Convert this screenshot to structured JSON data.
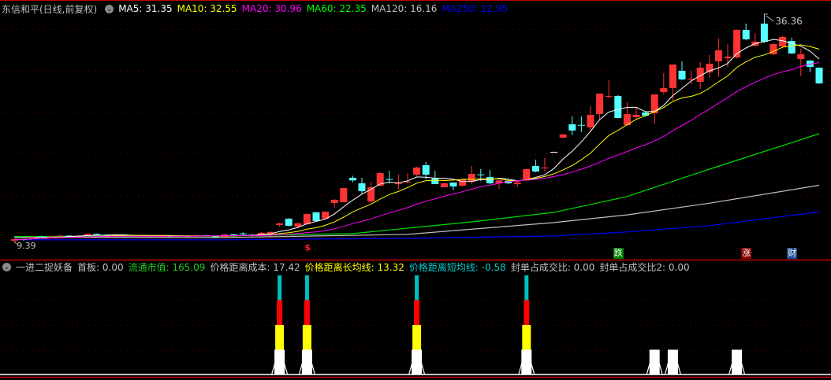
{
  "header": {
    "title": "东信和平(日线,前复权)",
    "ma": [
      {
        "label": "MA5: 31.35",
        "color": "#ffffff"
      },
      {
        "label": "MA10: 32.55",
        "color": "#ffff00"
      },
      {
        "label": "MA20: 30.96",
        "color": "#ff00ff"
      },
      {
        "label": "MA60: 22.35",
        "color": "#00ff00"
      },
      {
        "label": "MA120: 16.16",
        "color": "#c0c0c0"
      },
      {
        "label": "MA250: 12.95",
        "color": "#0000ff"
      }
    ]
  },
  "indicator": {
    "name": "一进二捉妖备",
    "items": [
      {
        "label": "首板: 0.00",
        "color": "#c0c0c0"
      },
      {
        "label": "流通市值: 165.09",
        "color": "#22cc22"
      },
      {
        "label": "价格距离成本: 17.42",
        "color": "#c0c0c0"
      },
      {
        "label": "价格距离长均线: 13.32",
        "color": "#ffff00"
      },
      {
        "label": "价格距离短均线: -0.58",
        "color": "#00cccc"
      },
      {
        "label": "封单占成交比: 0.00",
        "color": "#c0c0c0"
      },
      {
        "label": "封单占成交比2: 0.00",
        "color": "#c0c0c0"
      }
    ],
    "signals": [
      {
        "i": 29,
        "level": 4
      },
      {
        "i": 32,
        "level": 4
      },
      {
        "i": 44,
        "level": 4
      },
      {
        "i": 56,
        "level": 4
      },
      {
        "i": 70,
        "level": 1
      },
      {
        "i": 72,
        "level": 1
      },
      {
        "i": 79,
        "level": 1
      }
    ],
    "segment_colors": [
      "#ffffff",
      "#ffff00",
      "#ff0000",
      "#00c0c0"
    ]
  },
  "markers": {
    "high_label": "36.36",
    "low_label": "9.39",
    "tags": [
      {
        "text": "跌",
        "i": 66,
        "color": "#008000"
      },
      {
        "text": "涨",
        "i": 80,
        "color": "#8b0000"
      },
      {
        "text": "财",
        "i": 85,
        "color": "#1f4f8f"
      }
    ],
    "dollar": {
      "text": "$",
      "i": 32
    }
  },
  "colors": {
    "up": "#ff3333",
    "down": "#54ffff",
    "grid": "#8b0000",
    "border": "#c00000"
  },
  "chart_data": {
    "type": "candlestick",
    "price_range": [
      9.39,
      36.36
    ],
    "ohlc": [
      [
        9.5,
        9.65,
        9.7,
        9.39
      ],
      [
        9.7,
        9.6,
        9.75,
        9.5
      ],
      [
        9.8,
        9.9,
        10.0,
        9.75
      ],
      [
        10.0,
        9.95,
        10.1,
        9.9
      ],
      [
        9.9,
        10.0,
        10.05,
        9.85
      ],
      [
        10.05,
        10.1,
        10.2,
        10.0
      ],
      [
        10.1,
        10.05,
        10.15,
        9.95
      ],
      [
        10.0,
        10.1,
        10.15,
        9.95
      ],
      [
        10.1,
        10.3,
        10.35,
        10.05
      ],
      [
        10.3,
        10.2,
        10.35,
        10.1
      ],
      [
        10.2,
        10.15,
        10.25,
        10.1
      ],
      [
        10.1,
        10.2,
        10.3,
        10.05
      ],
      [
        10.2,
        10.1,
        10.25,
        10.0
      ],
      [
        10.1,
        10.05,
        10.2,
        10.0
      ],
      [
        10.0,
        10.1,
        10.15,
        9.95
      ],
      [
        10.1,
        10.0,
        10.15,
        9.95
      ],
      [
        9.95,
        10.05,
        10.1,
        9.9
      ],
      [
        10.05,
        10.0,
        10.1,
        9.9
      ],
      [
        10.0,
        10.1,
        10.2,
        9.95
      ],
      [
        10.1,
        10.0,
        10.15,
        9.95
      ],
      [
        10.0,
        10.15,
        10.2,
        9.95
      ],
      [
        10.15,
        10.05,
        10.2,
        10.0
      ],
      [
        10.0,
        9.95,
        10.1,
        9.85
      ],
      [
        9.97,
        10.25,
        10.3,
        9.9
      ],
      [
        10.25,
        10.06,
        10.3,
        10.0
      ],
      [
        10.37,
        10.35,
        10.5,
        10.2
      ],
      [
        10.2,
        10.1,
        10.3,
        10.0
      ],
      [
        10.16,
        10.44,
        10.55,
        10.1
      ],
      [
        10.35,
        10.54,
        10.65,
        10.3
      ],
      [
        11.39,
        11.57,
        11.67,
        11.2
      ],
      [
        12.14,
        11.29,
        12.2,
        11.2
      ],
      [
        11.2,
        11.57,
        11.7,
        11.1
      ],
      [
        11.48,
        12.71,
        12.75,
        11.4
      ],
      [
        12.9,
        11.86,
        12.95,
        11.8
      ],
      [
        12.14,
        12.99,
        13.0,
        12.1
      ],
      [
        14.03,
        14.41,
        14.5,
        13.47
      ],
      [
        14.13,
        15.83,
        15.85,
        14.1
      ],
      [
        17.06,
        16.74,
        17.3,
        16.5
      ],
      [
        16.39,
        15.45,
        17.06,
        15.17
      ],
      [
        14.22,
        15.92,
        16.58,
        14.03
      ],
      [
        16.11,
        17.63,
        17.7,
        16.0
      ],
      [
        16.9,
        16.87,
        17.91,
        16.39
      ],
      [
        16.3,
        16.39,
        17.44,
        15.64
      ],
      [
        16.55,
        16.6,
        17.63,
        16.4
      ],
      [
        17.44,
        18.29,
        18.4,
        17.3
      ],
      [
        18.57,
        17.44,
        18.95,
        16.87
      ],
      [
        16.97,
        16.3,
        17.91,
        16.3
      ],
      [
        15.92,
        16.39,
        16.45,
        15.9
      ],
      [
        16.49,
        16.02,
        16.5,
        15.54
      ],
      [
        16.11,
        16.87,
        16.9,
        16.0
      ],
      [
        16.58,
        17.53,
        18.48,
        16.3
      ],
      [
        17.46,
        17.44,
        18.1,
        16.68
      ],
      [
        17.16,
        16.39,
        18.01,
        16.3
      ],
      [
        16.39,
        16.74,
        16.8,
        15.73
      ],
      [
        16.68,
        16.39,
        16.75,
        16.3
      ],
      [
        16.3,
        16.49,
        16.55,
        15.92
      ],
      [
        16.74,
        18.1,
        18.15,
        16.7
      ],
      [
        18.48,
        17.81,
        19.24,
        17.72
      ],
      [
        18.25,
        18.29,
        19.43,
        17.81
      ],
      [
        20.18,
        20.18,
        20.18,
        20.18
      ],
      [
        21.89,
        22.27,
        22.3,
        21.8
      ],
      [
        23.49,
        22.74,
        24.44,
        22.17
      ],
      [
        23.42,
        23.4,
        24.44,
        22.55
      ],
      [
        23.12,
        24.63,
        25.67,
        22.74
      ],
      [
        24.72,
        27.18,
        27.2,
        24.06
      ],
      [
        26.88,
        26.9,
        28.79,
        26.62
      ],
      [
        26.9,
        24.25,
        27.0,
        24.2
      ],
      [
        23.4,
        24.72,
        26.14,
        23.3
      ],
      [
        24.35,
        24.63,
        25.48,
        24.06
      ],
      [
        24.91,
        24.54,
        25.0,
        24.4
      ],
      [
        24.82,
        27.09,
        27.1,
        23.49
      ],
      [
        27.37,
        27.85,
        29.64,
        27.09
      ],
      [
        27.85,
        30.68,
        30.7,
        26.33
      ],
      [
        29.93,
        28.89,
        31.06,
        28.8
      ],
      [
        28.96,
        28.98,
        29.93,
        28.32
      ],
      [
        28.6,
        30.3,
        30.97,
        27.75
      ],
      [
        29.74,
        30.78,
        31.82,
        29.08
      ],
      [
        31.06,
        32.39,
        33.81,
        29.17
      ],
      [
        31.44,
        31.63,
        33.14,
        30.4
      ],
      [
        31.54,
        34.85,
        34.9,
        31.4
      ],
      [
        34.85,
        33.71,
        35.6,
        33.6
      ],
      [
        32.95,
        33.43,
        34.47,
        32.77
      ],
      [
        35.6,
        33.43,
        36.36,
        33.3
      ],
      [
        31.91,
        33.14,
        33.2,
        31.8
      ],
      [
        32.86,
        34.0,
        34.1,
        32.77
      ],
      [
        33.52,
        32.01,
        33.9,
        31.95
      ],
      [
        31.35,
        31.91,
        32.58,
        29.27
      ],
      [
        31.16,
        30.4,
        31.2,
        29.74
      ],
      [
        30.3,
        28.41,
        30.35,
        28.35
      ]
    ],
    "computed_ma": [
      {
        "name": "MA5",
        "period": 5,
        "color": "#ffffff"
      },
      {
        "name": "MA10",
        "period": 10,
        "color": "#ffff00"
      },
      {
        "name": "MA20",
        "period": 20,
        "color": "#ff00ff"
      }
    ],
    "long_ma": [
      {
        "name": "MA60",
        "color": "#00dd00",
        "points": [
          [
            0,
            10.0
          ],
          [
            23,
            10.06
          ],
          [
            37,
            10.35
          ],
          [
            50,
            11.76
          ],
          [
            59,
            12.9
          ],
          [
            67,
            14.8
          ],
          [
            76,
            18.1
          ],
          [
            88,
            22.35
          ]
        ]
      },
      {
        "name": "MA120",
        "color": "#c0c0c0",
        "points": [
          [
            0,
            9.9
          ],
          [
            23,
            9.87
          ],
          [
            43,
            10.25
          ],
          [
            59,
            11.67
          ],
          [
            67,
            12.6
          ],
          [
            76,
            14.0
          ],
          [
            88,
            16.16
          ]
        ]
      },
      {
        "name": "MA250",
        "color": "#0000ff",
        "points": [
          [
            0,
            9.6
          ],
          [
            23,
            9.6
          ],
          [
            43,
            9.78
          ],
          [
            59,
            10.06
          ],
          [
            67,
            10.54
          ],
          [
            76,
            11.3
          ],
          [
            88,
            12.95
          ]
        ]
      }
    ]
  }
}
